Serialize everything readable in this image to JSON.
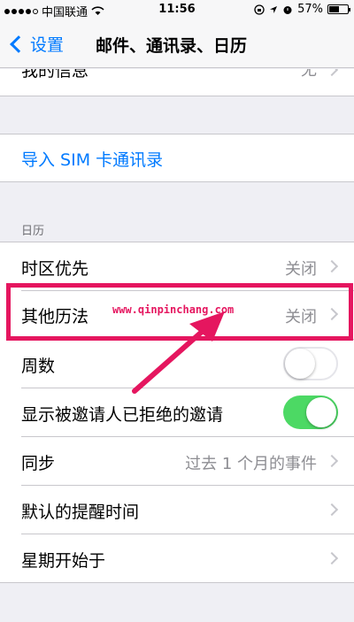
{
  "status_bar": {
    "carrier": "中国联通",
    "time": "11:56",
    "battery": "57%",
    "battery_level": 0.57
  },
  "nav": {
    "back_label": "设置",
    "title": "邮件、通讯录、日历"
  },
  "partial_row": {
    "label": "我的信息",
    "value": "无"
  },
  "import_sim": {
    "label": "导入 SIM 卡通讯录"
  },
  "calendar_section": {
    "header": "日历",
    "rows": [
      {
        "label": "时区优先",
        "value": "关闭"
      },
      {
        "label": "其他历法",
        "value": "关闭"
      },
      {
        "label": "周数",
        "toggle": "off"
      },
      {
        "label": "显示被邀请人已拒绝的邀请",
        "toggle": "on"
      },
      {
        "label": "同步",
        "value": "过去 1 个月的事件"
      },
      {
        "label": "默认的提醒时间",
        "value": ""
      },
      {
        "label": "星期开始于",
        "value": ""
      }
    ]
  },
  "annotation": {
    "watermark": "www.qinpinchang.com",
    "accent": "#e5165f"
  },
  "colors": {
    "ios_blue": "#007aff",
    "toggle_on": "#4cd964"
  }
}
